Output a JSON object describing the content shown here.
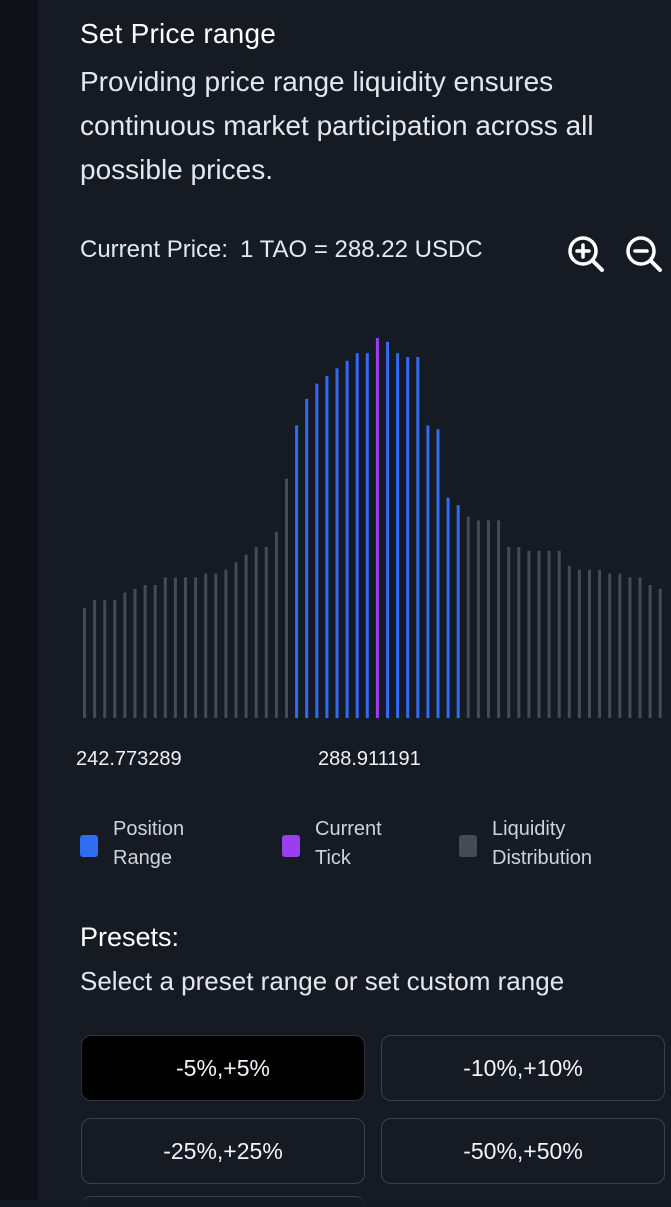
{
  "header": {
    "title": "Set Price range",
    "description": "Providing price range liquidity ensures continuous market participation across all possible prices."
  },
  "current_price": {
    "label": "Current Price:",
    "value": "1 TAO = 288.22 USDC"
  },
  "zoom": {
    "zoom_in_icon": "zoom-in-icon",
    "zoom_out_icon": "zoom-out-icon"
  },
  "chart_data": {
    "type": "bar",
    "values": [
      29,
      31,
      31,
      31,
      33,
      34,
      35,
      35,
      37,
      37,
      37,
      37,
      38,
      38,
      39,
      41,
      43,
      45,
      45,
      49,
      63,
      77,
      84,
      88,
      90,
      92,
      94,
      96,
      96,
      100,
      99,
      96,
      95,
      95,
      77,
      76,
      58,
      56,
      53,
      52,
      52,
      52,
      45,
      45,
      44,
      44,
      44,
      44,
      40,
      39,
      39,
      39,
      38,
      38,
      37,
      37,
      35,
      34
    ],
    "position_range_start": 21,
    "position_range_end": 37,
    "current_tick_index": 29,
    "tick_labels": [
      "242.773289",
      "288.911191"
    ]
  },
  "colors": {
    "position_range": "#2f6cf2",
    "current_tick": "#9b3ef0",
    "liquidity": "#454a57"
  },
  "legend": [
    {
      "line1": "Position",
      "line2": "Range"
    },
    {
      "line1": "Current",
      "line2": "Tick"
    },
    {
      "line1": "Liquidity",
      "line2": "Distribution"
    }
  ],
  "presets": {
    "title": "Presets:",
    "subtitle": "Select a preset range or set custom range",
    "options": [
      "-5%,+5%",
      "-10%,+10%",
      "-25%,+25%",
      "-50%,+50%"
    ],
    "selected_index": 0
  }
}
